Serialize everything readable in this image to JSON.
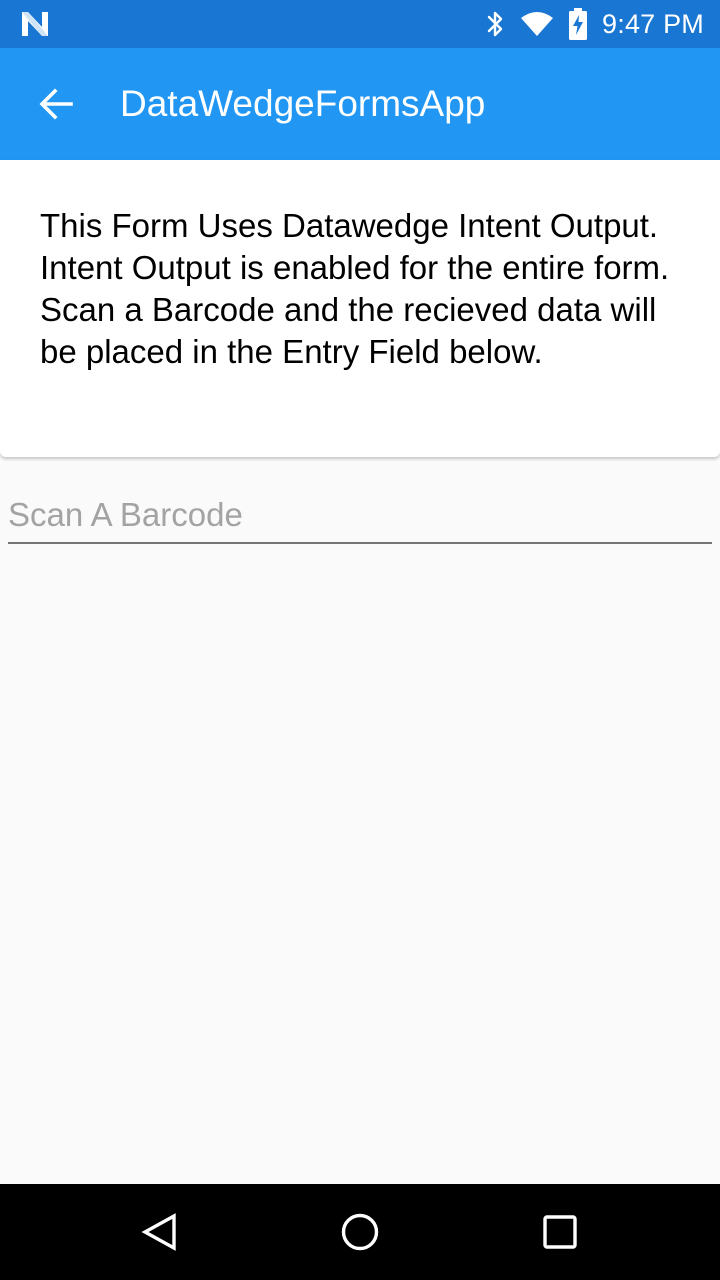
{
  "status_bar": {
    "time": "9:47 PM",
    "icons": [
      "notification-n-icon",
      "bluetooth-icon",
      "wifi-icon",
      "battery-charging-icon"
    ]
  },
  "app_bar": {
    "title": "DataWedgeFormsApp",
    "back_icon": "arrow-back-icon"
  },
  "info_card": {
    "text": "This Form Uses Datawedge Intent Output. Intent Output is enabled for the entire form. Scan a Barcode and the recieved data will be placed in the Entry Field below."
  },
  "scan_field": {
    "placeholder": "Scan A Barcode",
    "value": ""
  },
  "nav_bar": {
    "icons": [
      "nav-back-icon",
      "nav-home-icon",
      "nav-recents-icon"
    ]
  },
  "colors": {
    "status_bar": "#1976d2",
    "app_bar": "#2196f3",
    "background": "#fafafa",
    "nav_bar": "#000000"
  }
}
